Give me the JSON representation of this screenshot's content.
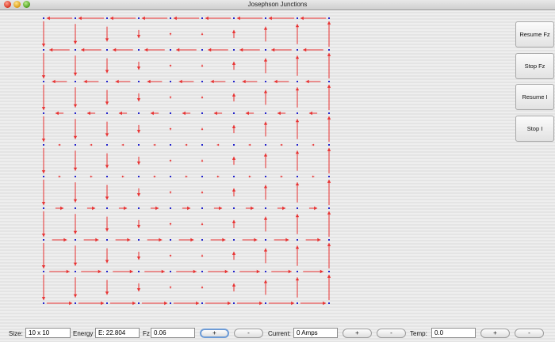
{
  "window": {
    "title": "Josephson Junctions"
  },
  "side_buttons": {
    "resume_fz": "Resume Fz",
    "stop_fz": "Stop Fz",
    "resume_i": "Resume I",
    "stop_i": "Stop I"
  },
  "controls": {
    "size_label": "Size:",
    "size_value": "10 x 10",
    "energy_label": "Energy",
    "energy_value": "E: 22.804",
    "fz_label": "Fz",
    "fz_value": "0.06",
    "plus": "+",
    "minus": "-",
    "current_label": "Current:",
    "current_value": "0 Amps",
    "temp_label": "Temp:",
    "temp_value": "0.0"
  },
  "colors": {
    "arrow": "#e83030",
    "node": "#2424cc"
  },
  "lattice": {
    "rows": 10,
    "cols": 10,
    "horizontal_magnitudes_by_row": [
      -0.95,
      -0.75,
      -0.55,
      -0.3,
      -0.08,
      0.08,
      0.3,
      0.55,
      0.75,
      0.95
    ],
    "vertical_magnitudes_by_col": [
      -0.95,
      -0.75,
      -0.55,
      -0.3,
      -0.08,
      0.08,
      0.3,
      0.55,
      0.75,
      0.95
    ]
  }
}
